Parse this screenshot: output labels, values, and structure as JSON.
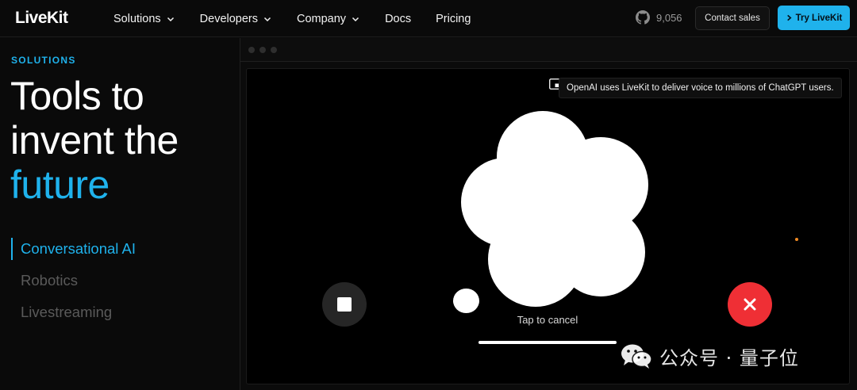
{
  "nav": {
    "logo": "LiveKit",
    "links": [
      {
        "label": "Solutions",
        "dropdown": true
      },
      {
        "label": "Developers",
        "dropdown": true
      },
      {
        "label": "Company",
        "dropdown": true
      },
      {
        "label": "Docs",
        "dropdown": false
      },
      {
        "label": "Pricing",
        "dropdown": false
      }
    ],
    "github_icon": "github-icon",
    "github_stars": "9,056",
    "contact_label": "Contact sales",
    "try_label": "Try LiveKit"
  },
  "hero": {
    "eyebrow": "SOLUTIONS",
    "headline_line1": "Tools to",
    "headline_line2": "invent the",
    "headline_accent": "future",
    "solutions": [
      {
        "label": "Conversational AI",
        "active": true
      },
      {
        "label": "Robotics",
        "active": false
      },
      {
        "label": "Livestreaming",
        "active": false
      }
    ]
  },
  "demo": {
    "caption": "OpenAI uses LiveKit to deliver voice to millions of ChatGPT users.",
    "tap_to_cancel": "Tap to cancel",
    "stop_icon": "stop-icon",
    "cancel_icon": "close-icon"
  },
  "watermark": {
    "text": "公众号 · 量子位",
    "icon": "wechat-icon"
  },
  "colors": {
    "accent": "#1fb2ec",
    "danger": "#ef2f35",
    "background": "#0a0a0a"
  }
}
